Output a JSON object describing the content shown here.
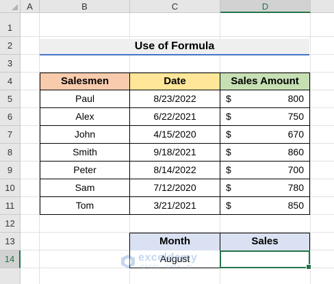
{
  "columns": [
    "A",
    "B",
    "C",
    "D"
  ],
  "rows": [
    "1",
    "2",
    "3",
    "4",
    "5",
    "6",
    "7",
    "8",
    "9",
    "10",
    "11",
    "12",
    "13",
    "14"
  ],
  "selected_column": "D",
  "selected_row": "14",
  "title": "Use of Formula",
  "table": {
    "headers": [
      "Salesmen",
      "Date",
      "Sales Amount"
    ],
    "header_colors": [
      "#f8cbad",
      "#ffe699",
      "#c6e0b4"
    ],
    "currency_symbol": "$",
    "rows": [
      {
        "name": "Paul",
        "date": "8/23/2022",
        "amount": "800"
      },
      {
        "name": "Alex",
        "date": "6/22/2021",
        "amount": "750"
      },
      {
        "name": "John",
        "date": "4/15/2020",
        "amount": "670"
      },
      {
        "name": "Smith",
        "date": "9/18/2021",
        "amount": "860"
      },
      {
        "name": "Peter",
        "date": "8/14/2022",
        "amount": "700"
      },
      {
        "name": "Sam",
        "date": "7/12/2020",
        "amount": "780"
      },
      {
        "name": "Tom",
        "date": "3/21/2021",
        "amount": "850"
      }
    ]
  },
  "lookup": {
    "header_color": "#d9e1f2",
    "month_header": "Month",
    "sales_header": "Sales",
    "month_value": "August",
    "sales_value": ""
  },
  "watermark": {
    "brand": "exceldemy",
    "tagline": "EXCEL · DATA · BI"
  }
}
